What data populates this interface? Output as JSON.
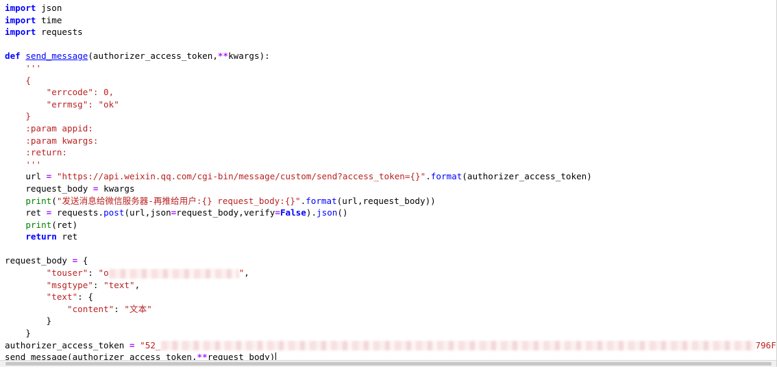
{
  "editor": {
    "lines": [
      [
        {
          "k": "kw",
          "t": "import"
        },
        {
          "k": "",
          "t": " json"
        }
      ],
      [
        {
          "k": "kw",
          "t": "import"
        },
        {
          "k": "",
          "t": " time"
        }
      ],
      [
        {
          "k": "kw",
          "t": "import"
        },
        {
          "k": "",
          "t": " requests"
        }
      ],
      [],
      [
        {
          "k": "kw",
          "t": "def"
        },
        {
          "k": "",
          "t": " "
        },
        {
          "k": "fn",
          "t": "send_message"
        },
        {
          "k": "",
          "t": "(authorizer_access_token,"
        },
        {
          "k": "op",
          "t": "**"
        },
        {
          "k": "",
          "t": "kwargs):"
        }
      ],
      [
        {
          "k": "str",
          "t": "    '''"
        }
      ],
      [
        {
          "k": "str",
          "t": "    {"
        }
      ],
      [
        {
          "k": "str",
          "t": "        \"errcode\": 0,"
        }
      ],
      [
        {
          "k": "str",
          "t": "        \"errmsg\": \"ok\""
        }
      ],
      [
        {
          "k": "str",
          "t": "    }"
        }
      ],
      [
        {
          "k": "str",
          "t": "    :param appid:"
        }
      ],
      [
        {
          "k": "str",
          "t": "    :param kwargs:"
        }
      ],
      [
        {
          "k": "str",
          "t": "    :return:"
        }
      ],
      [
        {
          "k": "str",
          "t": "    '''"
        }
      ],
      [
        {
          "k": "",
          "t": "    url "
        },
        {
          "k": "op",
          "t": "="
        },
        {
          "k": "",
          "t": " "
        },
        {
          "k": "str",
          "t": "\"https://api.weixin.qq.com/cgi-bin/message/custom/send?access_token={}\""
        },
        {
          "k": "",
          "t": "."
        },
        {
          "k": "fn2",
          "t": "format"
        },
        {
          "k": "",
          "t": "(authorizer_access_token)"
        }
      ],
      [
        {
          "k": "",
          "t": "    request_body "
        },
        {
          "k": "op",
          "t": "="
        },
        {
          "k": "",
          "t": " kwargs"
        }
      ],
      [
        {
          "k": "",
          "t": "    "
        },
        {
          "k": "bi",
          "t": "print"
        },
        {
          "k": "",
          "t": "("
        },
        {
          "k": "str",
          "t": "\"发送消息给微信服务器-再推给用户:{} request_body:{}\""
        },
        {
          "k": "",
          "t": "."
        },
        {
          "k": "fn2",
          "t": "format"
        },
        {
          "k": "",
          "t": "(url,request_body))"
        }
      ],
      [
        {
          "k": "",
          "t": "    ret "
        },
        {
          "k": "op",
          "t": "="
        },
        {
          "k": "",
          "t": " requests."
        },
        {
          "k": "fn2",
          "t": "post"
        },
        {
          "k": "",
          "t": "(url,json"
        },
        {
          "k": "op",
          "t": "="
        },
        {
          "k": "",
          "t": "request_body,verify"
        },
        {
          "k": "op",
          "t": "="
        },
        {
          "k": "kw",
          "t": "False"
        },
        {
          "k": "",
          "t": ")."
        },
        {
          "k": "fn2",
          "t": "json"
        },
        {
          "k": "",
          "t": "()"
        }
      ],
      [
        {
          "k": "",
          "t": "    "
        },
        {
          "k": "bi",
          "t": "print"
        },
        {
          "k": "",
          "t": "(ret)"
        }
      ],
      [
        {
          "k": "",
          "t": "    "
        },
        {
          "k": "kw",
          "t": "return"
        },
        {
          "k": "",
          "t": " ret"
        }
      ],
      [],
      [
        {
          "k": "",
          "t": "request_body "
        },
        {
          "k": "op",
          "t": "="
        },
        {
          "k": "",
          "t": " {"
        }
      ],
      [
        {
          "k": "",
          "t": "        "
        },
        {
          "k": "str",
          "t": "\"touser\""
        },
        {
          "k": "",
          "t": ": "
        },
        {
          "k": "str",
          "t": "\"o"
        },
        {
          "k": "blur",
          "t": "",
          "w": 190
        },
        {
          "k": "str",
          "t": "\""
        },
        {
          "k": "",
          "t": ","
        }
      ],
      [
        {
          "k": "",
          "t": "        "
        },
        {
          "k": "str",
          "t": "\"msgtype\""
        },
        {
          "k": "",
          "t": ": "
        },
        {
          "k": "str",
          "t": "\"text\""
        },
        {
          "k": "",
          "t": ","
        }
      ],
      [
        {
          "k": "",
          "t": "        "
        },
        {
          "k": "str",
          "t": "\"text\""
        },
        {
          "k": "",
          "t": ": {"
        }
      ],
      [
        {
          "k": "",
          "t": "            "
        },
        {
          "k": "str",
          "t": "\"content\""
        },
        {
          "k": "",
          "t": ": "
        },
        {
          "k": "str",
          "t": "\"文本\""
        }
      ],
      [
        {
          "k": "",
          "t": "        }"
        }
      ],
      [
        {
          "k": "",
          "t": "    }"
        }
      ],
      [
        {
          "k": "",
          "t": "authorizer_access_token "
        },
        {
          "k": "op",
          "t": "="
        },
        {
          "k": "",
          "t": " "
        },
        {
          "k": "str",
          "t": "\"52_"
        },
        {
          "k": "blur",
          "t": "",
          "w": 868
        },
        {
          "k": "str",
          "t": "796F"
        }
      ],
      [
        {
          "k": "",
          "t": "send_message(authorizer_access_token,"
        },
        {
          "k": "op",
          "t": "**"
        },
        {
          "k": "",
          "t": "request_body)"
        },
        {
          "k": "caret",
          "t": ""
        }
      ]
    ]
  },
  "colors": {
    "keyword": "#0000ff",
    "string": "#ba2121",
    "builtin": "#008000",
    "operator": "#aa22ff"
  }
}
